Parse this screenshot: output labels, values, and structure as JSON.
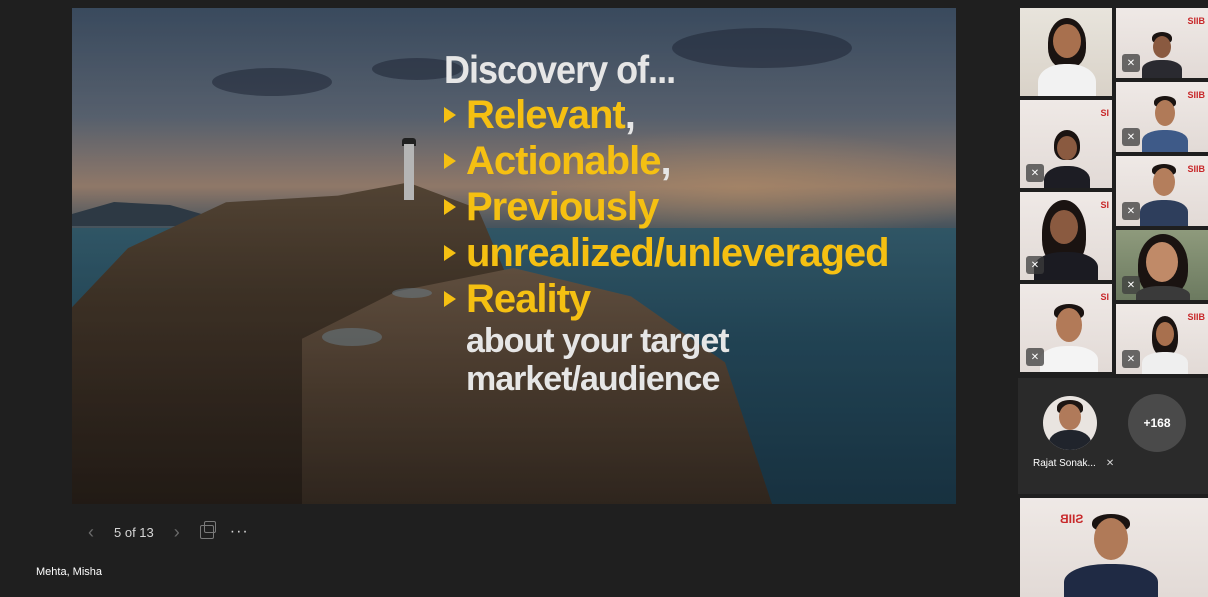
{
  "slide": {
    "heading": "Discovery of...",
    "bullets": [
      {
        "text": "Relevant",
        "suffix": ","
      },
      {
        "text": "Actionable",
        "suffix": ","
      },
      {
        "text": "Previously",
        "suffix": ""
      },
      {
        "text": "unrealized/unleveraged",
        "suffix": ""
      },
      {
        "text": "Reality",
        "suffix": ""
      }
    ],
    "tail_line1": "about your target",
    "tail_line2": "market/audience"
  },
  "controls": {
    "prev_icon": "chevron-left-icon",
    "pager": "5 of 13",
    "next_icon": "chevron-right-icon",
    "more": "···"
  },
  "presenter": {
    "name": "Mehta, Misha"
  },
  "participants": {
    "logo_text": "SIIB",
    "logo_text_short": "SI",
    "logo_text_mirrored": "SIIB",
    "overflow_count": "+168",
    "spotlight_name": "Rajat Sonak...",
    "mic_off_symbol": "🎙"
  },
  "colors": {
    "accent_yellow": "#f5c012",
    "active_tile": "#7b83eb",
    "logo_red": "#c8282a"
  }
}
